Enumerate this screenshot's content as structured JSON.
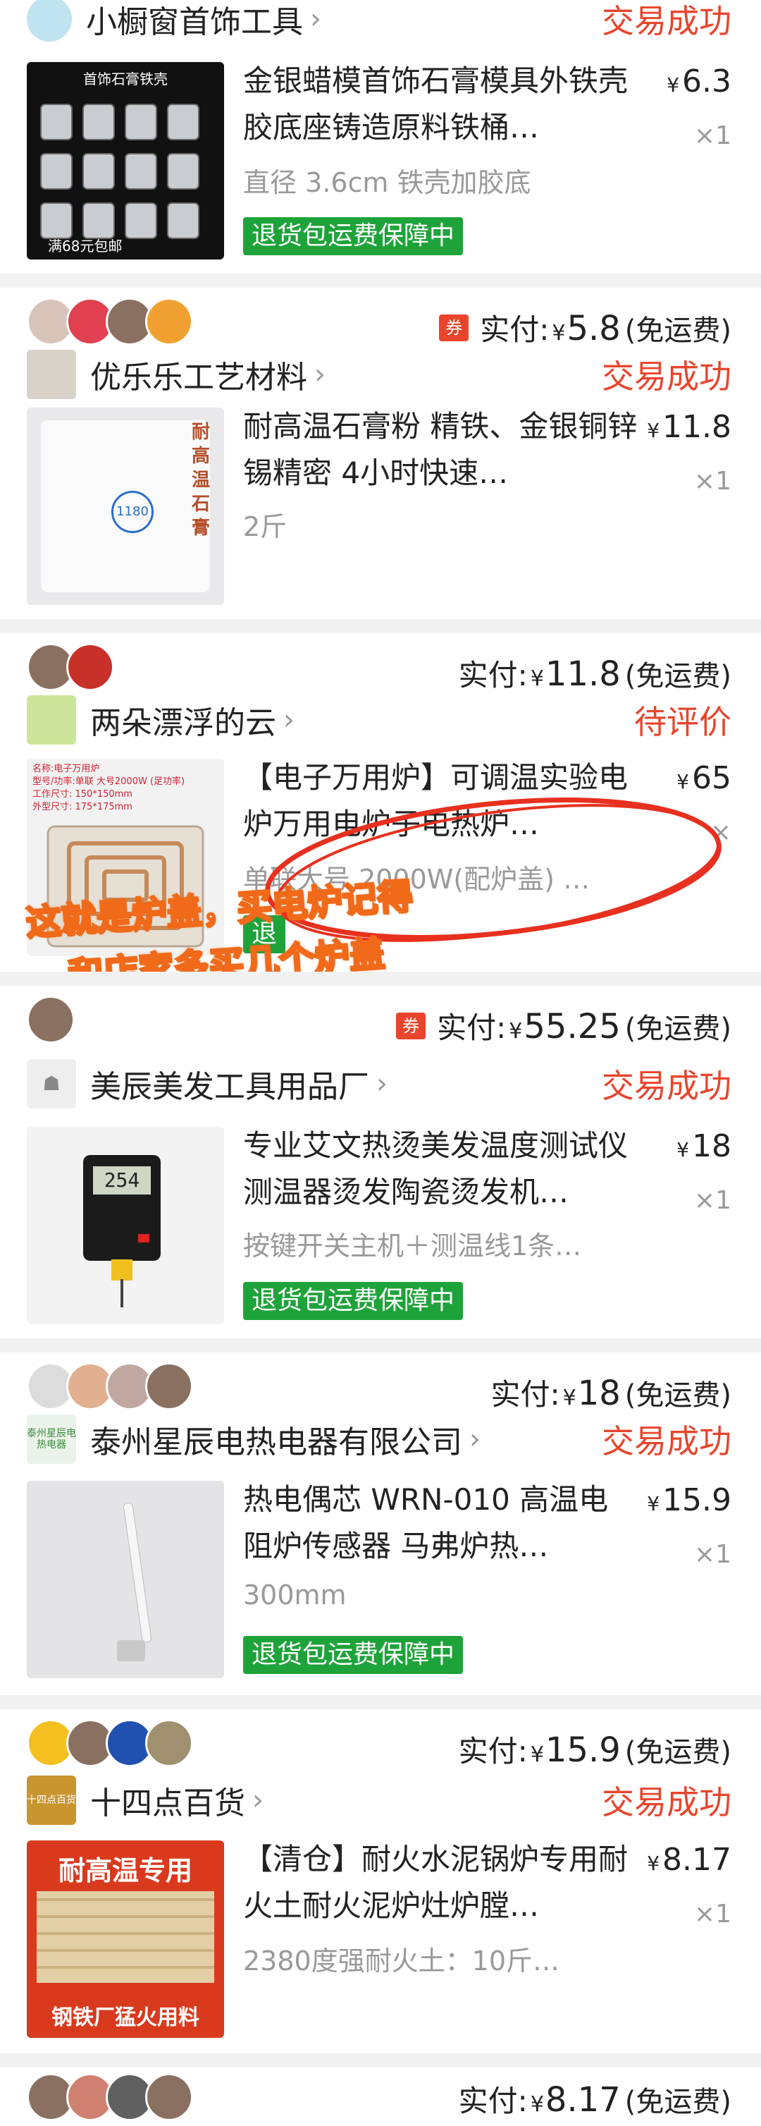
{
  "colors": {
    "accent": "#e8452c",
    "guarantee": "#1ea33a",
    "muted": "#999999"
  },
  "orders": [
    {
      "shop": "小橱窗首饰工具",
      "status": "交易成功",
      "item": {
        "title": "金银蜡模首饰石膏模具外铁壳胶底座铸造原料铁桶…",
        "price": "6.3",
        "qty": "×1",
        "sku": "直径 3.6cm 铁壳加胶底",
        "guarantee": "退货包运费保障中",
        "thumb_caption_top": "首饰石膏铁壳",
        "thumb_caption_bottom": "满68元包邮"
      }
    },
    {
      "paid_label": "实付:",
      "paid_amount": "5.8",
      "freight": "(免运费)",
      "coupon": "券",
      "shop": "优乐乐工艺材料",
      "status": "交易成功",
      "item": {
        "title": "耐高温石膏粉 精铁、金银铜锌锡精密 4小时快速…",
        "price": "11.8",
        "qty": "×1",
        "sku": "2斤",
        "thumb_caption": "耐高温石膏",
        "thumb_badge": "1180"
      }
    },
    {
      "paid_label": "实付:",
      "paid_amount": "11.8",
      "freight": "(免运费)",
      "shop": "两朵漂浮的云",
      "status": "待评价",
      "item": {
        "title": "【电子万用炉】可调温实验电炉万用电炉子电热炉…",
        "price": "65",
        "qty": "×",
        "sku": "单联大号 2000W(配炉盖) …",
        "guarantee": "退",
        "thumb_lines": [
          "名称:电子万用炉",
          "型号/功率:单联 大号2000W (足功率)",
          "工作尺寸: 150*150mm",
          "外型尺寸: 175*175mm"
        ]
      },
      "overlay_line1": "这就是炉盖，买电炉记得",
      "overlay_line2": "和店家多买几个炉盖"
    },
    {
      "paid_label": "实付:",
      "paid_amount": "55.25",
      "freight": "(免运费)",
      "coupon": "券",
      "shop": "美辰美发工具用品厂",
      "status": "交易成功",
      "item": {
        "title": "专业艾文热烫美发温度测试仪测温器烫发陶瓷烫发机…",
        "price": "18",
        "qty": "×1",
        "sku": "按键开关主机＋测温线1条…",
        "guarantee": "退货包运费保障中",
        "thumb_display": "254"
      }
    },
    {
      "paid_label": "实付:",
      "paid_amount": "18",
      "freight": "(免运费)",
      "shop": "泰州星辰电热电器有限公司",
      "shop_icon_text": "泰州星辰电热电器",
      "status": "交易成功",
      "item": {
        "title": "热电偶芯 WRN-010 高温电阻炉传感器 马弗炉热…",
        "price": "15.9",
        "qty": "×1",
        "sku": "300mm",
        "guarantee": "退货包运费保障中"
      }
    },
    {
      "paid_label": "实付:",
      "paid_amount": "15.9",
      "freight": "(免运费)",
      "shop": "十四点百货",
      "shop_icon_text": "十四点百货",
      "status": "交易成功",
      "item": {
        "title": "【清仓】耐火水泥锅炉专用耐火土耐火泥炉灶炉膛…",
        "price": "8.17",
        "qty": "×1",
        "sku": "2380度强耐火土：10斤…",
        "thumb_top": "耐高温专用",
        "thumb_bottom": "钢铁厂猛火用料"
      }
    },
    {
      "paid_label": "实付:",
      "paid_amount": "8.17",
      "freight": "(免运费)"
    }
  ]
}
